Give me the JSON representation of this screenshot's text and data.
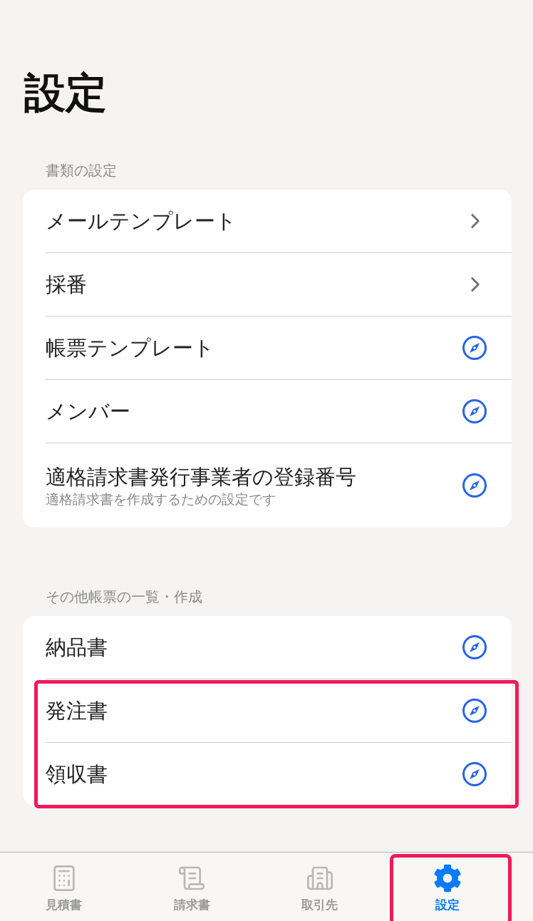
{
  "title": "設定",
  "sections": [
    {
      "header": "書類の設定",
      "rows": [
        {
          "kind": "navigate",
          "label": "メールテンプレート",
          "highlighted": false
        },
        {
          "kind": "navigate",
          "label": "採番",
          "highlighted": false
        },
        {
          "kind": "open",
          "label": "帳票テンプレート",
          "highlighted": false
        },
        {
          "kind": "open",
          "label": "メンバー",
          "highlighted": false
        },
        {
          "kind": "open",
          "label": "適格請求書発行事業者の登録番号",
          "subtitle": "適格請求書を作成するための設定です",
          "highlighted": false
        }
      ]
    },
    {
      "header": "その他帳票の一覧・作成",
      "rows": [
        {
          "kind": "open",
          "label": "納品書",
          "highlighted": false
        },
        {
          "kind": "open",
          "label": "発注書",
          "highlighted": true
        },
        {
          "kind": "open",
          "label": "領収書",
          "highlighted": true
        }
      ]
    }
  ],
  "tab_bar": [
    {
      "label": "見積書",
      "selected": false,
      "highlighted": false
    },
    {
      "label": "請求書",
      "selected": false,
      "highlighted": false
    },
    {
      "label": "取引先",
      "selected": false,
      "highlighted": false
    },
    {
      "label": "設定",
      "selected": true,
      "highlighted": true
    }
  ]
}
